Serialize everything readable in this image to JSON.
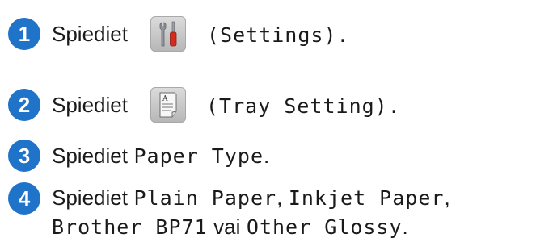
{
  "steps": [
    {
      "number": "1",
      "prefix": "Spiediet",
      "icon": "settings-tools-icon",
      "suffix": "(Settings)."
    },
    {
      "number": "2",
      "prefix": "Spiediet",
      "icon": "tray-setting-icon",
      "suffix": "(Tray Setting)."
    },
    {
      "number": "3",
      "prefix": "Spiediet",
      "option": "Paper Type",
      "suffix": "."
    },
    {
      "number": "4",
      "prefix": "Spiediet",
      "option1": "Plain Paper",
      "sep1": ",",
      "option2": "Inkjet Paper",
      "sep2": ",",
      "option3": "Brother BP71",
      "conj": "vai",
      "option4": "Other Glossy",
      "end": "."
    }
  ],
  "colors": {
    "badge": "#1f73c9",
    "tool_red": "#d42b1e"
  }
}
